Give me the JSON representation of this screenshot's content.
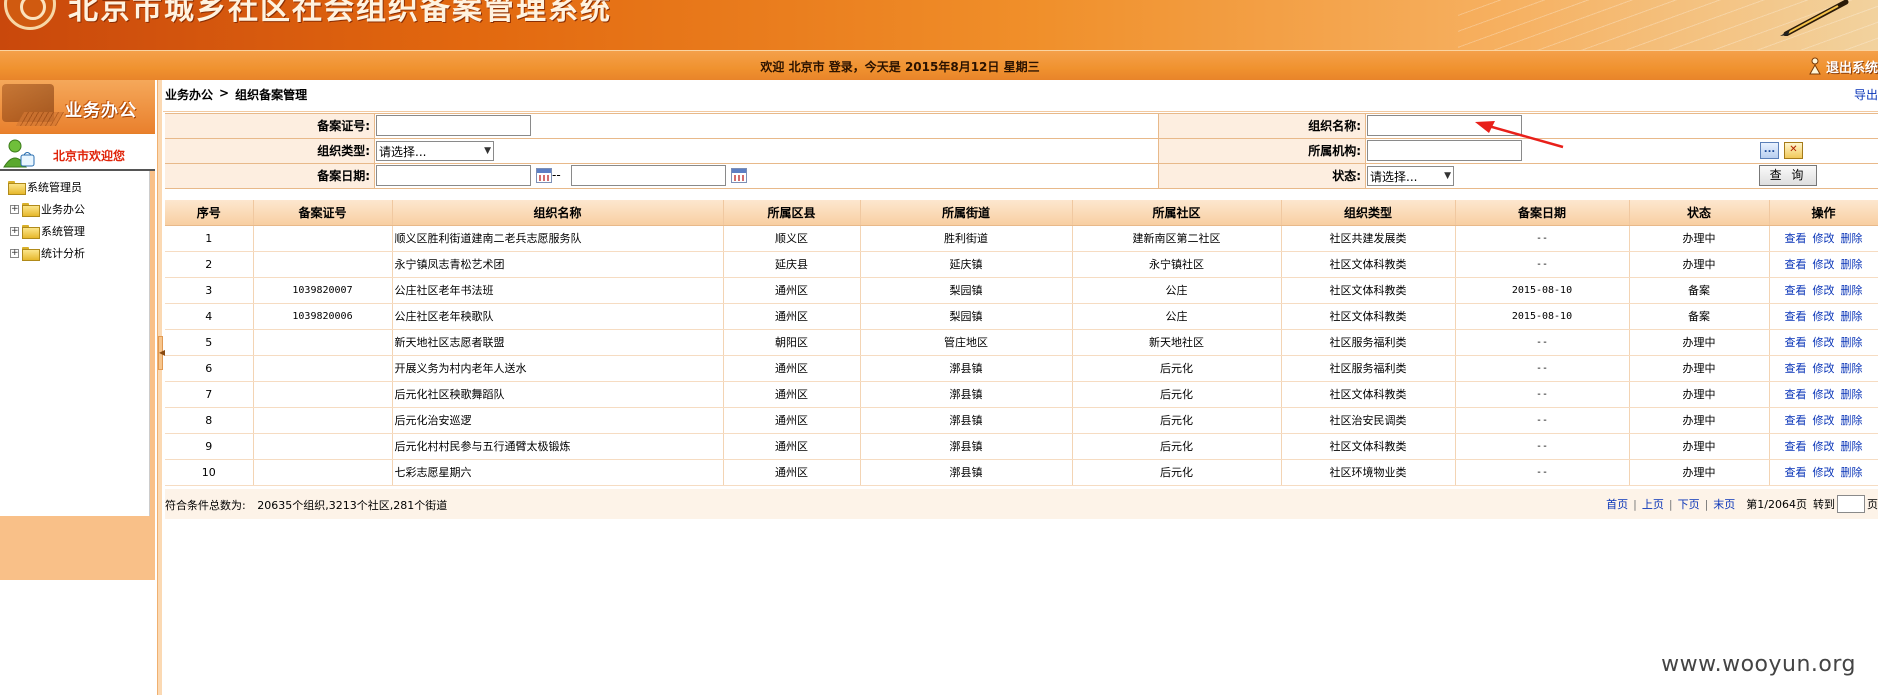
{
  "header": {
    "system_title": "北京市城乡社区社会组织备案管理系统",
    "welcome_text": "欢迎 北京市 登录，今天是 2015年8月12日 星期三",
    "logout_label": "退出系统"
  },
  "sidebar": {
    "section_title": "业务办公",
    "user_welcome": "北京市欢迎您",
    "tree_root": "系统管理员",
    "tree_items": [
      {
        "label": "业务办公"
      },
      {
        "label": "系统管理"
      },
      {
        "label": "统计分析"
      }
    ]
  },
  "breadcrumb": {
    "parent": "业务办公",
    "separator": ">",
    "current": "组织备案管理",
    "export_label": "导出"
  },
  "search": {
    "record_no_label": "备案证号:",
    "record_no_value": "",
    "org_name_label": "组织名称:",
    "org_name_value": "",
    "org_type_label": "组织类型:",
    "org_type_selected": "请选择...",
    "agency_label": "所属机构:",
    "agency_value": "",
    "date_label": "备案日期:",
    "date_from": "",
    "date_sep": "--",
    "date_to": "",
    "status_label": "状态:",
    "status_selected": "请选择...",
    "query_label": "查 询",
    "browse_label": "...",
    "clear_label": "✕"
  },
  "table": {
    "columns": [
      "序号",
      "备案证号",
      "组织名称",
      "所属区县",
      "所属街道",
      "所属社区",
      "组织类型",
      "备案日期",
      "状态",
      "操作"
    ],
    "actions": [
      "查看",
      "修改",
      "删除"
    ],
    "rows": [
      {
        "no": "1",
        "record_no": "",
        "name": "顺义区胜利街道建南二老兵志愿服务队",
        "district": "顺义区",
        "street": "胜利街道",
        "community": "建新南区第二社区",
        "type": "社区共建发展类",
        "date": "--",
        "status": "办理中"
      },
      {
        "no": "2",
        "record_no": "",
        "name": "永宁镇凤志青松艺术团",
        "district": "延庆县",
        "street": "延庆镇",
        "community": "永宁镇社区",
        "type": "社区文体科教类",
        "date": "--",
        "status": "办理中"
      },
      {
        "no": "3",
        "record_no": "1039820007",
        "name": "公庄社区老年书法班",
        "district": "通州区",
        "street": "梨园镇",
        "community": "公庄",
        "type": "社区文体科教类",
        "date": "2015-08-10",
        "status": "备案"
      },
      {
        "no": "4",
        "record_no": "1039820006",
        "name": "公庄社区老年秧歌队",
        "district": "通州区",
        "street": "梨园镇",
        "community": "公庄",
        "type": "社区文体科教类",
        "date": "2015-08-10",
        "status": "备案"
      },
      {
        "no": "5",
        "record_no": "",
        "name": "新天地社区志愿者联盟",
        "district": "朝阳区",
        "street": "管庄地区",
        "community": "新天地社区",
        "type": "社区服务福利类",
        "date": "--",
        "status": "办理中"
      },
      {
        "no": "6",
        "record_no": "",
        "name": "开展义务为村内老年人送水",
        "district": "通州区",
        "street": "漷县镇",
        "community": "后元化",
        "type": "社区服务福利类",
        "date": "--",
        "status": "办理中"
      },
      {
        "no": "7",
        "record_no": "",
        "name": "后元化社区秧歌舞蹈队",
        "district": "通州区",
        "street": "漷县镇",
        "community": "后元化",
        "type": "社区文体科教类",
        "date": "--",
        "status": "办理中"
      },
      {
        "no": "8",
        "record_no": "",
        "name": "后元化治安巡逻",
        "district": "通州区",
        "street": "漷县镇",
        "community": "后元化",
        "type": "社区治安民调类",
        "date": "--",
        "status": "办理中"
      },
      {
        "no": "9",
        "record_no": "",
        "name": "后元化村村民参与五行通臂太极锻炼",
        "district": "通州区",
        "street": "漷县镇",
        "community": "后元化",
        "type": "社区文体科教类",
        "date": "--",
        "status": "办理中"
      },
      {
        "no": "10",
        "record_no": "",
        "name": "七彩志愿星期六",
        "district": "通州区",
        "street": "漷县镇",
        "community": "后元化",
        "type": "社区环境物业类",
        "date": "--",
        "status": "办理中"
      }
    ]
  },
  "footer": {
    "summary_label": "符合条件总数为:",
    "summary_value": "20635个组织,3213个社区,281个街道",
    "first": "首页",
    "prev": "上页",
    "next": "下页",
    "last": "末页",
    "page_info": "第1/2064页",
    "goto_label": "转到",
    "page_suffix": "页"
  },
  "watermark": "www.wooyun.org"
}
